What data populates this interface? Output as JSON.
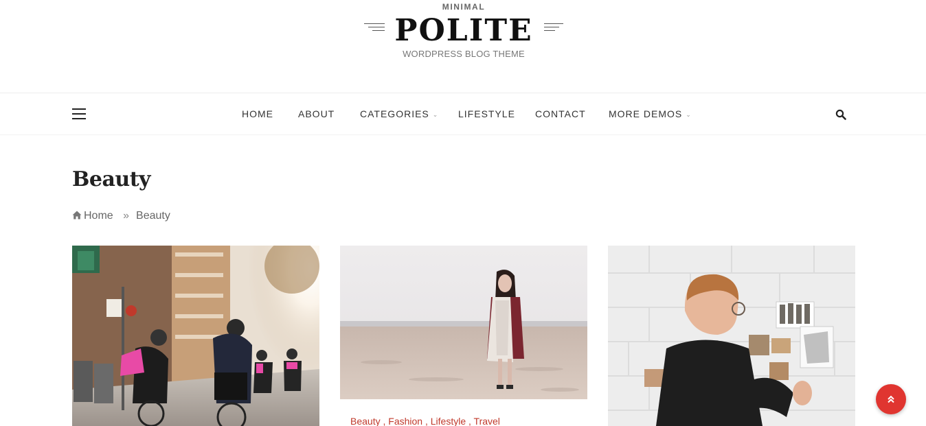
{
  "header": {
    "tagline_top": "MINIMAL",
    "title": "POLITE",
    "subtitle": "WORDPRESS BLOG THEME"
  },
  "nav": {
    "menu_icon": "hamburger-icon",
    "items": [
      {
        "label": "HOME",
        "has_dropdown": false
      },
      {
        "label": "ABOUT",
        "has_dropdown": false
      },
      {
        "label": "CATEGORIES",
        "has_dropdown": true
      },
      {
        "label": "LIFESTYLE",
        "has_dropdown": false
      },
      {
        "label": "CONTACT",
        "has_dropdown": false
      },
      {
        "label": "MORE DEMOS",
        "has_dropdown": true
      }
    ],
    "search_icon": "search-icon"
  },
  "page": {
    "title": "Beauty",
    "breadcrumb": {
      "home": "Home",
      "separator": "»",
      "current": "Beauty"
    }
  },
  "posts": [
    {
      "image": "cyclists-on-city-street",
      "categories": []
    },
    {
      "image": "woman-on-beach",
      "categories": [
        "Beauty",
        "Fashion",
        "Lifestyle",
        "Travel"
      ]
    },
    {
      "image": "man-pinning-photos-on-wall",
      "categories": []
    }
  ],
  "scroll_top": {
    "icon": "double-chevron-up-icon"
  },
  "colors": {
    "accent": "#e03530",
    "category_link": "#c0392b",
    "text_dark": "#222222"
  }
}
